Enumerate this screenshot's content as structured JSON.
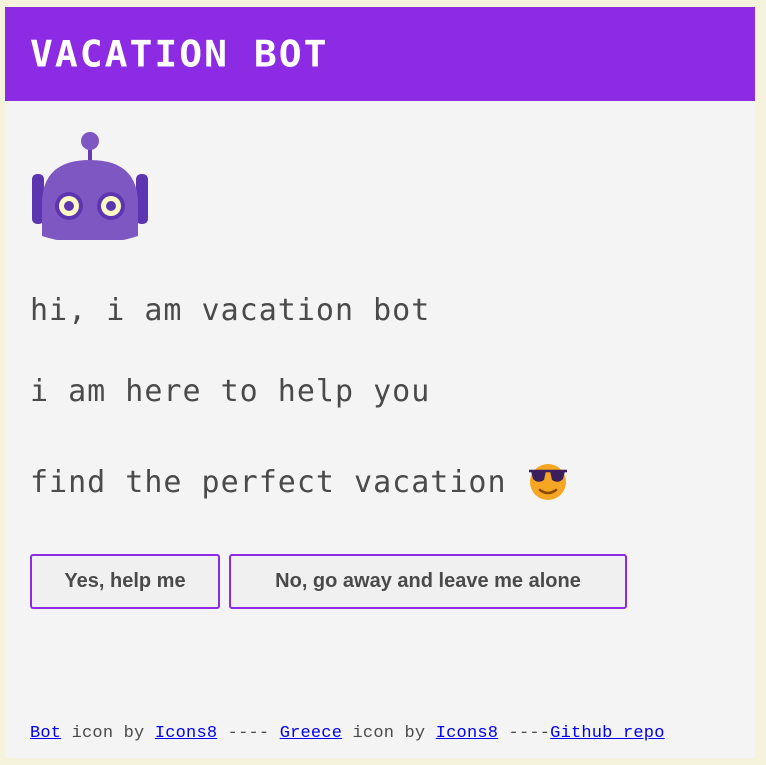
{
  "header": {
    "title": "VACATION BOT",
    "background_color": "#8c2be3"
  },
  "bot": {
    "icon": "robot-head-icon"
  },
  "messages": {
    "line1": "hi, i am vacation bot",
    "line2": "i am here to help you",
    "line3": "find the perfect vacation",
    "line3_icon": "sunglasses-face-icon"
  },
  "buttons": {
    "yes_label": "Yes, help me",
    "no_label": "No, go away and leave me alone",
    "border_color": "#8c2be3"
  },
  "footer": {
    "bot_link": "Bot",
    "icon_by_1": " icon by ",
    "icons8_link_1": "Icons8",
    "separator_1": " ---- ",
    "greece_link": "Greece",
    "icon_by_2": " icon by ",
    "icons8_link_2": "Icons8",
    "separator_2": " ----",
    "github_link": "Github repo"
  }
}
